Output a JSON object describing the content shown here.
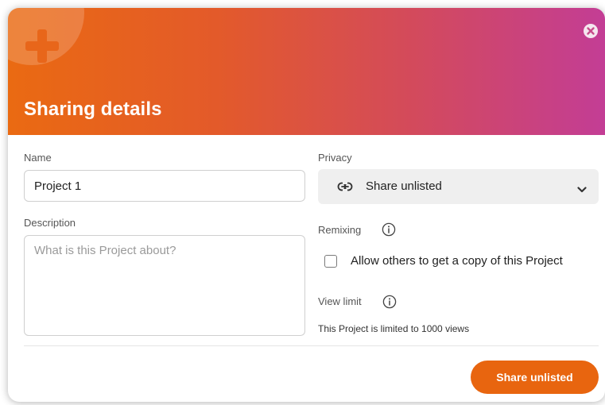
{
  "dialog": {
    "title": "Sharing details",
    "header_gradient": [
      "#ea6a12",
      "#c33d95"
    ],
    "accent_color": "#e8650f"
  },
  "icons": {
    "header": "plus-icon",
    "close": "close-icon",
    "privacy": "link-icon",
    "dropdown": "chevron-down-icon",
    "info": "info-icon"
  },
  "form": {
    "name": {
      "label": "Name",
      "value": "Project 1"
    },
    "description": {
      "label": "Description",
      "placeholder": "What is this Project about?",
      "value": ""
    },
    "privacy": {
      "label": "Privacy",
      "selected": "Share unlisted"
    },
    "remixing": {
      "label": "Remixing",
      "checkbox_label": "Allow others to get a copy of this Project",
      "checked": false
    },
    "view_limit": {
      "label": "View limit",
      "text": "This Project is limited to 1000 views"
    }
  },
  "actions": {
    "primary_label": "Share unlisted"
  }
}
